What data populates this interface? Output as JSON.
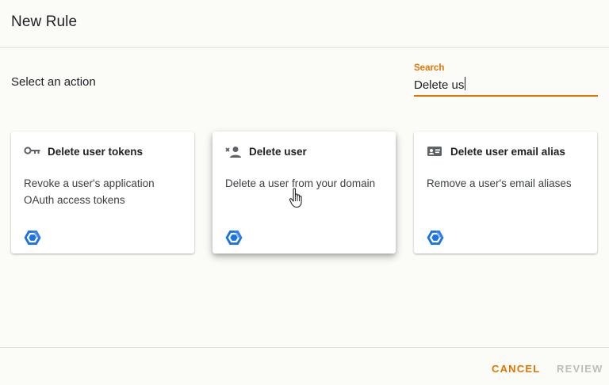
{
  "dialog": {
    "title": "New Rule",
    "select_label": "Select an action"
  },
  "search": {
    "label": "Search",
    "value": "Delete us"
  },
  "cards": [
    {
      "icon": "key-icon",
      "title": "Delete user tokens",
      "desc_line1": "Revoke a user's application",
      "desc_line2": "OAuth access tokens",
      "logo": "google-cloud-hexagon-icon"
    },
    {
      "icon": "person-remove-icon",
      "title": "Delete user",
      "desc_line1": "Delete a user from your domain",
      "desc_line2": "",
      "logo": "google-cloud-hexagon-icon"
    },
    {
      "icon": "contact-card-icon",
      "title": "Delete user email alias",
      "desc_line1": "Remove a user's email aliases",
      "desc_line2": "",
      "logo": "google-cloud-hexagon-icon"
    }
  ],
  "footer": {
    "cancel_label": "CANCEL",
    "review_label": "REVIEW"
  },
  "colors": {
    "accent": "#e37400",
    "logo_blue": "#1a73e8",
    "disabled": "#bdbdbd"
  }
}
